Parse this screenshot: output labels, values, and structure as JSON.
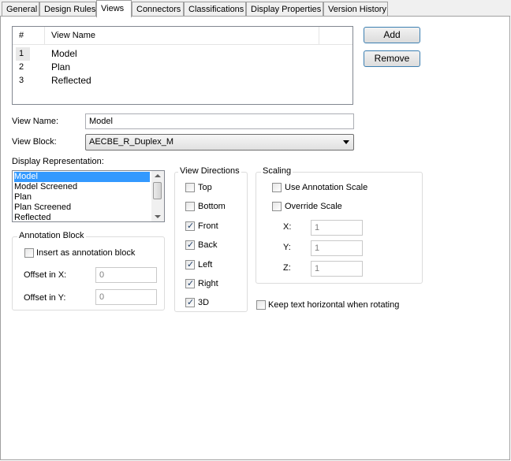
{
  "tabs": [
    {
      "label": "General"
    },
    {
      "label": "Design Rules"
    },
    {
      "label": "Views"
    },
    {
      "label": "Connectors"
    },
    {
      "label": "Classifications"
    },
    {
      "label": "Display Properties"
    },
    {
      "label": "Version History"
    }
  ],
  "views_table": {
    "columns": [
      "#",
      "View Name"
    ],
    "rows": [
      {
        "num": "1",
        "name": "Model"
      },
      {
        "num": "2",
        "name": "Plan"
      },
      {
        "num": "3",
        "name": "Reflected"
      }
    ]
  },
  "buttons": {
    "add": "Add",
    "remove": "Remove"
  },
  "view_name": {
    "label": "View Name:",
    "value": "Model"
  },
  "view_block": {
    "label": "View Block:",
    "value": "AECBE_R_Duplex_M"
  },
  "display_rep": {
    "label": "Display Representation:",
    "items": [
      "Model",
      "Model Screened",
      "Plan",
      "Plan Screened",
      "Reflected"
    ],
    "selected": "Model"
  },
  "annotation_block": {
    "title": "Annotation Block",
    "insert_label": "Insert as annotation block",
    "insert_checked": false,
    "offset_x_label": "Offset in X:",
    "offset_x_value": "0",
    "offset_y_label": "Offset in Y:",
    "offset_y_value": "0"
  },
  "view_directions": {
    "title": "View Directions",
    "items": [
      {
        "label": "Top",
        "checked": false
      },
      {
        "label": "Bottom",
        "checked": false
      },
      {
        "label": "Front",
        "checked": true
      },
      {
        "label": "Back",
        "checked": true
      },
      {
        "label": "Left",
        "checked": true
      },
      {
        "label": "Right",
        "checked": true
      },
      {
        "label": "3D",
        "checked": true
      }
    ]
  },
  "scaling": {
    "title": "Scaling",
    "use_annotation_label": "Use Annotation Scale",
    "use_annotation_checked": false,
    "override_label": "Override Scale",
    "override_checked": false,
    "x_label": "X:",
    "x_value": "1",
    "y_label": "Y:",
    "y_value": "1",
    "z_label": "Z:",
    "z_value": "1"
  },
  "keep_text": {
    "label": "Keep text horizontal when rotating",
    "checked": false
  }
}
